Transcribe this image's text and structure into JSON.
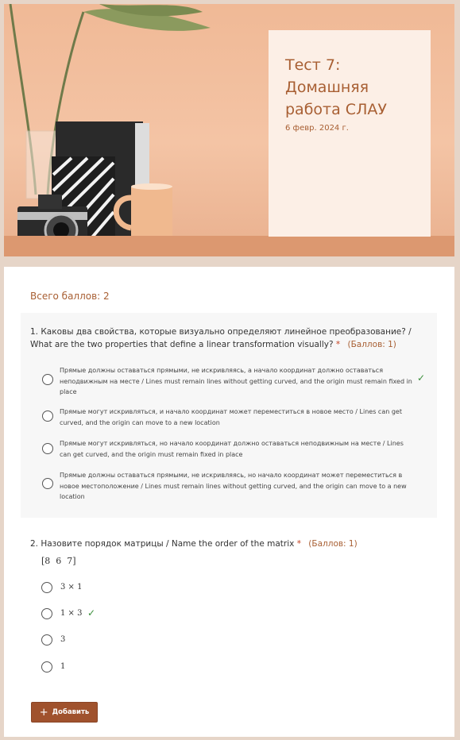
{
  "header": {
    "title": "Тест 7: Домашняя работа СЛАУ",
    "date": "6 февр. 2024 г."
  },
  "total_points": "Всего баллов: 2",
  "question1": {
    "title": "1. Каковы два свойства, которые визуально определяют линейное преобразование? / What are the two properties that define a linear transformation visually?",
    "required_mark": "*",
    "points": "(Баллов: 1)",
    "options": [
      {
        "label": "Прямые должны оставаться прямыми, не искривляясь, а начало координат должно оставаться неподвижным на месте / Lines must remain lines without getting curved, and the origin must remain fixed in place",
        "correct": true
      },
      {
        "label": "Прямые могут искривляться, и начало координат может переместиться в новое место / Lines can get curved, and the origin can move to a new location",
        "correct": false
      },
      {
        "label": "Прямые могут искривляться, но начало координат должно оставаться неподвижным на месте / Lines can get curved, and the origin must remain fixed in place",
        "correct": false
      },
      {
        "label": "Прямые должны оставаться прямыми, не искривляясь, но начало координат может переместиться в новое местоположение / Lines must remain lines without getting curved, and the origin can move to a new location",
        "correct": false
      }
    ]
  },
  "question2": {
    "title": "2. Назовите порядок матрицы / Name the order of the matrix",
    "required_mark": "*",
    "points": "(Баллов: 1)",
    "matrix": "[8  6  7]",
    "options": [
      {
        "label": "3 × 1",
        "correct": false
      },
      {
        "label": "1 × 3",
        "correct": true
      },
      {
        "label": "3",
        "correct": false
      },
      {
        "label": "1",
        "correct": false
      }
    ]
  },
  "add_button": {
    "label": "Добавить",
    "icon": "plus-icon"
  },
  "colors": {
    "accent": "#a85f33",
    "button": "#a0522d",
    "check": "#3b8f3b",
    "required": "#c4401f"
  }
}
